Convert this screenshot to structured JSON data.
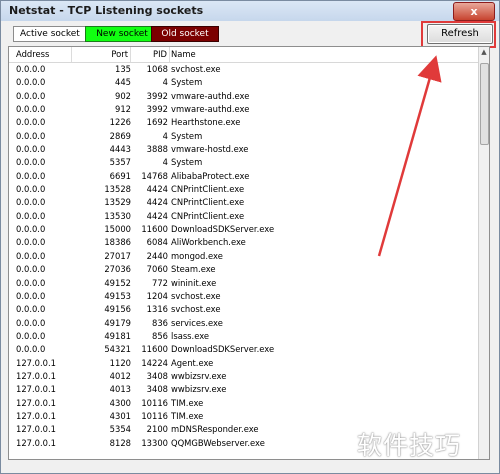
{
  "window": {
    "title": "Netstat - TCP Listening sockets",
    "close_label": "x"
  },
  "legend": {
    "active": "Active socket",
    "new": "New socket",
    "old": "Old socket"
  },
  "toolbar": {
    "refresh_label": "Refresh"
  },
  "table": {
    "columns": [
      "Address",
      "Port",
      "PID",
      "Name"
    ],
    "rows": [
      {
        "address": "0.0.0.0",
        "port": "135",
        "pid": "1068",
        "name": "svchost.exe"
      },
      {
        "address": "0.0.0.0",
        "port": "445",
        "pid": "4",
        "name": "System"
      },
      {
        "address": "0.0.0.0",
        "port": "902",
        "pid": "3992",
        "name": "vmware-authd.exe"
      },
      {
        "address": "0.0.0.0",
        "port": "912",
        "pid": "3992",
        "name": "vmware-authd.exe"
      },
      {
        "address": "0.0.0.0",
        "port": "1226",
        "pid": "1692",
        "name": "Hearthstone.exe"
      },
      {
        "address": "0.0.0.0",
        "port": "2869",
        "pid": "4",
        "name": "System"
      },
      {
        "address": "0.0.0.0",
        "port": "4443",
        "pid": "3888",
        "name": "vmware-hostd.exe"
      },
      {
        "address": "0.0.0.0",
        "port": "5357",
        "pid": "4",
        "name": "System"
      },
      {
        "address": "0.0.0.0",
        "port": "6691",
        "pid": "14768",
        "name": "AlibabaProtect.exe"
      },
      {
        "address": "0.0.0.0",
        "port": "13528",
        "pid": "4424",
        "name": "CNPrintClient.exe"
      },
      {
        "address": "0.0.0.0",
        "port": "13529",
        "pid": "4424",
        "name": "CNPrintClient.exe"
      },
      {
        "address": "0.0.0.0",
        "port": "13530",
        "pid": "4424",
        "name": "CNPrintClient.exe"
      },
      {
        "address": "0.0.0.0",
        "port": "15000",
        "pid": "11600",
        "name": "DownloadSDKServer.exe"
      },
      {
        "address": "0.0.0.0",
        "port": "18386",
        "pid": "6084",
        "name": "AliWorkbench.exe"
      },
      {
        "address": "0.0.0.0",
        "port": "27017",
        "pid": "2440",
        "name": "mongod.exe"
      },
      {
        "address": "0.0.0.0",
        "port": "27036",
        "pid": "7060",
        "name": "Steam.exe"
      },
      {
        "address": "0.0.0.0",
        "port": "49152",
        "pid": "772",
        "name": "wininit.exe"
      },
      {
        "address": "0.0.0.0",
        "port": "49153",
        "pid": "1204",
        "name": "svchost.exe"
      },
      {
        "address": "0.0.0.0",
        "port": "49156",
        "pid": "1316",
        "name": "svchost.exe"
      },
      {
        "address": "0.0.0.0",
        "port": "49179",
        "pid": "836",
        "name": "services.exe"
      },
      {
        "address": "0.0.0.0",
        "port": "49181",
        "pid": "856",
        "name": "lsass.exe"
      },
      {
        "address": "0.0.0.0",
        "port": "54321",
        "pid": "11600",
        "name": "DownloadSDKServer.exe"
      },
      {
        "address": "127.0.0.1",
        "port": "1120",
        "pid": "14224",
        "name": "Agent.exe"
      },
      {
        "address": "127.0.0.1",
        "port": "4012",
        "pid": "3408",
        "name": "wwbizsrv.exe"
      },
      {
        "address": "127.0.0.1",
        "port": "4013",
        "pid": "3408",
        "name": "wwbizsrv.exe"
      },
      {
        "address": "127.0.0.1",
        "port": "4300",
        "pid": "10116",
        "name": "TIM.exe"
      },
      {
        "address": "127.0.0.1",
        "port": "4301",
        "pid": "10116",
        "name": "TIM.exe"
      },
      {
        "address": "127.0.0.1",
        "port": "5354",
        "pid": "2100",
        "name": "mDNSResponder.exe"
      },
      {
        "address": "127.0.0.1",
        "port": "8128",
        "pid": "13300",
        "name": "QQMGBWebserver.exe"
      }
    ]
  },
  "watermark": "软件技巧",
  "colors": {
    "new_socket": "#11ff11",
    "old_socket": "#7b0000",
    "annotation": "#e03a3a"
  }
}
